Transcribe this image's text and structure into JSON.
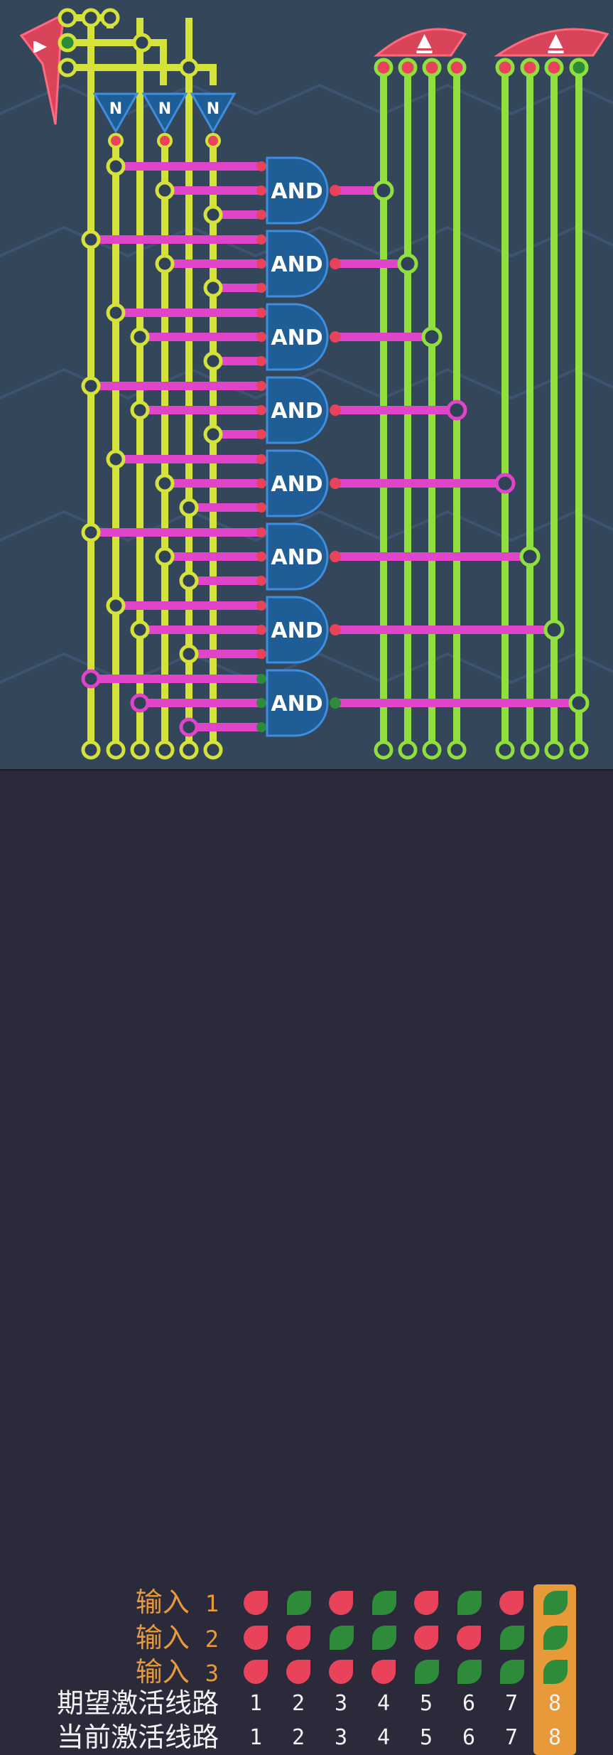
{
  "board": {
    "gate_label": "AND",
    "not_label": "N",
    "gate_count": 8,
    "wire_colors": {
      "input_bus": "#d4e23a",
      "and_input": "#e044c8",
      "output_bus": "#8fe03c",
      "on_pin": "#2e8b3a",
      "off_pin": "#e8435a",
      "gate": "#1f5d96",
      "background": "#34465a"
    }
  },
  "panel": {
    "rows": [
      {
        "label": "输入",
        "num": "1",
        "type": "input",
        "values": [
          0,
          1,
          0,
          1,
          0,
          1,
          0,
          1
        ]
      },
      {
        "label": "输入",
        "num": "2",
        "type": "input",
        "values": [
          0,
          0,
          1,
          1,
          0,
          0,
          1,
          1
        ]
      },
      {
        "label": "输入",
        "num": "3",
        "type": "input",
        "values": [
          0,
          0,
          0,
          0,
          1,
          1,
          1,
          1
        ]
      },
      {
        "label": "期望激活线路",
        "type": "numbers",
        "values": [
          "1",
          "2",
          "3",
          "4",
          "5",
          "6",
          "7",
          "8"
        ]
      },
      {
        "label": "当前激活线路",
        "type": "numbers",
        "values": [
          "1",
          "2",
          "3",
          "4",
          "5",
          "6",
          "7",
          "8"
        ]
      }
    ],
    "highlight_column": 8,
    "colors": {
      "on": "#2e8b3a",
      "off": "#e8435a",
      "highlight": "#e8993a",
      "label_orange": "#e8993a",
      "label_white": "#f2f2f2"
    }
  }
}
